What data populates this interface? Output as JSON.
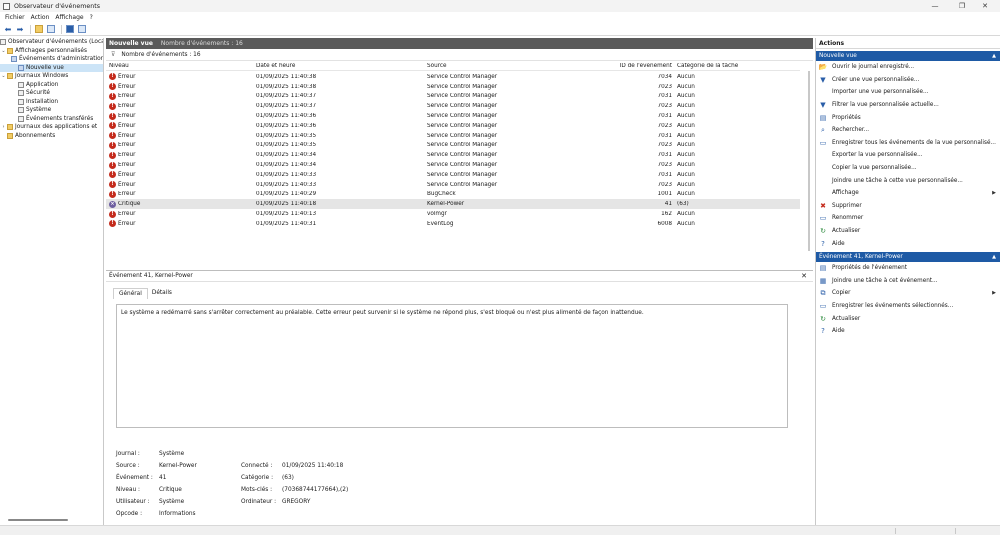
{
  "window": {
    "title": "Observateur d'événements",
    "minimize": "—",
    "maximize": "❐",
    "close": "✕"
  },
  "menu": [
    "Fichier",
    "Action",
    "Affichage",
    "?"
  ],
  "tree": [
    {
      "label": "Observateur d'événements (Local)",
      "indent": 0,
      "arrow": "",
      "icon": "event-viewer-icon"
    },
    {
      "label": "Affichages personnalisés",
      "indent": 0,
      "arrow": "⌄",
      "icon": "folder-icon"
    },
    {
      "label": "Événements d'administration",
      "indent": 1,
      "arrow": "",
      "icon": "filter-icon"
    },
    {
      "label": "Nouvelle vue",
      "indent": 1,
      "arrow": "",
      "icon": "filter-icon",
      "selected": true
    },
    {
      "label": "Journaux Windows",
      "indent": 0,
      "arrow": "⌄",
      "icon": "folder-icon"
    },
    {
      "label": "Application",
      "indent": 1,
      "arrow": "",
      "icon": "log-icon"
    },
    {
      "label": "Sécurité",
      "indent": 1,
      "arrow": "",
      "icon": "log-icon"
    },
    {
      "label": "Installation",
      "indent": 1,
      "arrow": "",
      "icon": "log-icon"
    },
    {
      "label": "Système",
      "indent": 1,
      "arrow": "",
      "icon": "log-icon"
    },
    {
      "label": "Événements transférés",
      "indent": 1,
      "arrow": "",
      "icon": "log-icon"
    },
    {
      "label": "Journaux des applications et",
      "indent": 0,
      "arrow": "›",
      "icon": "folder-icon"
    },
    {
      "label": "Abonnements",
      "indent": 0,
      "arrow": "",
      "icon": "folder-icon"
    }
  ],
  "center": {
    "title": "Nouvelle vue",
    "count": "Nombre d'événements : 16",
    "filter_text": "Nombre d'événements : 16",
    "columns": {
      "level": "Niveau",
      "date": "Date et heure",
      "source": "Source",
      "id": "ID de l'événement",
      "task": "Catégorie de la tâche"
    },
    "rows": [
      {
        "level": "Erreur",
        "date": "01/09/2025 11:40:38",
        "source": "Service Control Manager",
        "id": "7034",
        "task": "Aucun"
      },
      {
        "level": "Erreur",
        "date": "01/09/2025 11:40:38",
        "source": "Service Control Manager",
        "id": "7023",
        "task": "Aucun"
      },
      {
        "level": "Erreur",
        "date": "01/09/2025 11:40:37",
        "source": "Service Control Manager",
        "id": "7031",
        "task": "Aucun"
      },
      {
        "level": "Erreur",
        "date": "01/09/2025 11:40:37",
        "source": "Service Control Manager",
        "id": "7023",
        "task": "Aucun"
      },
      {
        "level": "Erreur",
        "date": "01/09/2025 11:40:36",
        "source": "Service Control Manager",
        "id": "7031",
        "task": "Aucun"
      },
      {
        "level": "Erreur",
        "date": "01/09/2025 11:40:36",
        "source": "Service Control Manager",
        "id": "7023",
        "task": "Aucun"
      },
      {
        "level": "Erreur",
        "date": "01/09/2025 11:40:35",
        "source": "Service Control Manager",
        "id": "7031",
        "task": "Aucun"
      },
      {
        "level": "Erreur",
        "date": "01/09/2025 11:40:35",
        "source": "Service Control Manager",
        "id": "7023",
        "task": "Aucun"
      },
      {
        "level": "Erreur",
        "date": "01/09/2025 11:40:34",
        "source": "Service Control Manager",
        "id": "7031",
        "task": "Aucun"
      },
      {
        "level": "Erreur",
        "date": "01/09/2025 11:40:34",
        "source": "Service Control Manager",
        "id": "7023",
        "task": "Aucun"
      },
      {
        "level": "Erreur",
        "date": "01/09/2025 11:40:33",
        "source": "Service Control Manager",
        "id": "7031",
        "task": "Aucun"
      },
      {
        "level": "Erreur",
        "date": "01/09/2025 11:40:33",
        "source": "Service Control Manager",
        "id": "7023",
        "task": "Aucun"
      },
      {
        "level": "Erreur",
        "date": "01/09/2025 11:40:29",
        "source": "BugCheck",
        "id": "1001",
        "task": "Aucun"
      },
      {
        "level": "Critique",
        "date": "01/09/2025 11:40:18",
        "source": "Kernel-Power",
        "id": "41",
        "task": "(63)",
        "selected": true
      },
      {
        "level": "Erreur",
        "date": "01/09/2025 11:40:13",
        "source": "volmgr",
        "id": "162",
        "task": "Aucun"
      },
      {
        "level": "Erreur",
        "date": "01/09/2025 11:40:31",
        "source": "EventLog",
        "id": "6008",
        "task": "Aucun"
      }
    ]
  },
  "detail": {
    "title": "Événement 41, Kernel-Power",
    "close": "✕",
    "tab_general": "Général",
    "tab_details": "Détails",
    "description": "Le système a redémarré sans s'arrêter correctement au préalable. Cette erreur peut survenir si le système ne répond plus, s'est bloqué ou n'est plus alimenté de façon inattendue.",
    "fields": {
      "journal_label": "Journal :",
      "journal": "Système",
      "source_label": "Source :",
      "source": "Kernel-Power",
      "event_label": "Événement :",
      "event": "41",
      "level_label": "Niveau :",
      "level": "Critique",
      "user_label": "Utilisateur :",
      "user": "Système",
      "opcode_label": "Opcode :",
      "opcode": "Informations",
      "logged_label": "Connecté :",
      "logged": "01/09/2025 11:40:18",
      "category_label": "Catégorie :",
      "category": "(63)",
      "keywords_label": "Mots-clés :",
      "keywords": "(70368744177664),(2)",
      "computer_label": "Ordinateur :",
      "computer": "GREGORY"
    }
  },
  "actions": {
    "header": "Actions",
    "section1": "Nouvelle vue",
    "section1_items": [
      {
        "label": "Ouvrir le journal enregistré...",
        "icon": "open-log-icon",
        "glyph": "📂"
      },
      {
        "label": "Créer une vue personnalisée...",
        "icon": "create-view-icon",
        "glyph": "▼"
      },
      {
        "label": "Importer une vue personnalisée...",
        "icon": "",
        "glyph": ""
      },
      {
        "label": "Filtrer la vue personnalisée actuelle...",
        "icon": "filter-icon",
        "glyph": "▼"
      },
      {
        "label": "Propriétés",
        "icon": "properties-icon",
        "glyph": "▤"
      },
      {
        "label": "Rechercher...",
        "icon": "find-icon",
        "glyph": "⌕"
      },
      {
        "label": "Enregistrer tous les événements de la vue personnalisé...",
        "icon": "save-icon",
        "glyph": "▭"
      },
      {
        "label": "Exporter la vue personnalisée...",
        "icon": "",
        "glyph": ""
      },
      {
        "label": "Copier la vue personnalisée...",
        "icon": "",
        "glyph": ""
      },
      {
        "label": "Joindre une tâche à cette vue personnalisée...",
        "icon": "",
        "glyph": ""
      },
      {
        "label": "Affichage",
        "icon": "",
        "glyph": "",
        "submenu": "▶"
      },
      {
        "label": "Supprimer",
        "icon": "delete-icon",
        "glyph": "✖"
      },
      {
        "label": "Renommer",
        "icon": "rename-icon",
        "glyph": "▭"
      },
      {
        "label": "Actualiser",
        "icon": "refresh-icon",
        "glyph": "↻"
      },
      {
        "label": "Aide",
        "icon": "help-icon",
        "glyph": "?"
      }
    ],
    "section2": "Événement 41, Kernel-Power",
    "section2_items": [
      {
        "label": "Propriétés de l'événement",
        "icon": "event-properties-icon",
        "glyph": "▤"
      },
      {
        "label": "Joindre une tâche à cet événement...",
        "icon": "attach-task-icon",
        "glyph": "▦"
      },
      {
        "label": "Copier",
        "icon": "copy-icon",
        "glyph": "⧉",
        "submenu": "▶"
      },
      {
        "label": "Enregistrer les événements sélectionnés...",
        "icon": "save-icon",
        "glyph": "▭"
      },
      {
        "label": "Actualiser",
        "icon": "refresh-icon",
        "glyph": "↻"
      },
      {
        "label": "Aide",
        "icon": "help-icon",
        "glyph": "?"
      }
    ],
    "collapse": "▲"
  },
  "colors": {
    "accent": "#1e5aa5",
    "error": "#c42b1c",
    "critical": "#6e5fa0",
    "header_dark": "#5a5a5a"
  }
}
